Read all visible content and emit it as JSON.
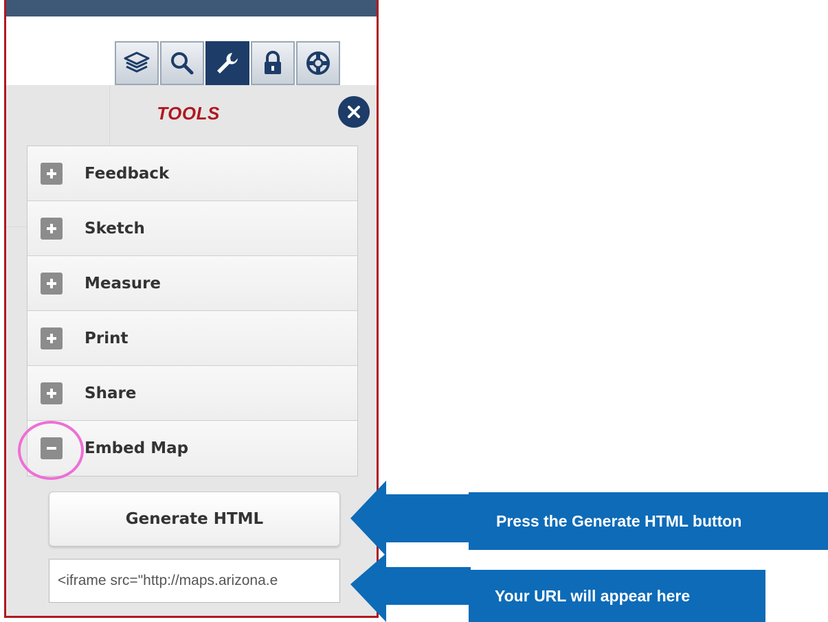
{
  "toolbar": {
    "buttons": [
      {
        "icon": "layers-icon",
        "active": false
      },
      {
        "icon": "search-icon",
        "active": false
      },
      {
        "icon": "wrench-icon",
        "active": true
      },
      {
        "icon": "lock-icon",
        "active": false
      },
      {
        "icon": "lifebuoy-icon",
        "active": false
      }
    ]
  },
  "panel": {
    "title": "TOOLS",
    "close_icon": "close-icon"
  },
  "tools": [
    {
      "label": "Feedback",
      "state": "collapsed"
    },
    {
      "label": "Sketch",
      "state": "collapsed"
    },
    {
      "label": "Measure",
      "state": "collapsed"
    },
    {
      "label": "Print",
      "state": "collapsed"
    },
    {
      "label": "Share",
      "state": "collapsed"
    },
    {
      "label": "Embed Map",
      "state": "expanded"
    }
  ],
  "embed": {
    "generate_label": "Generate HTML",
    "output_value": "<iframe src=\"http://maps.arizona.e"
  },
  "annotations": {
    "generate_callout": "Press the Generate HTML button",
    "url_callout": "Your URL will appear here"
  },
  "colors": {
    "panel_border": "#b01820",
    "title": "#b01820",
    "active_button": "#1d3c68",
    "highlight": "#ee6fd6",
    "callout": "#0d6bb8"
  }
}
